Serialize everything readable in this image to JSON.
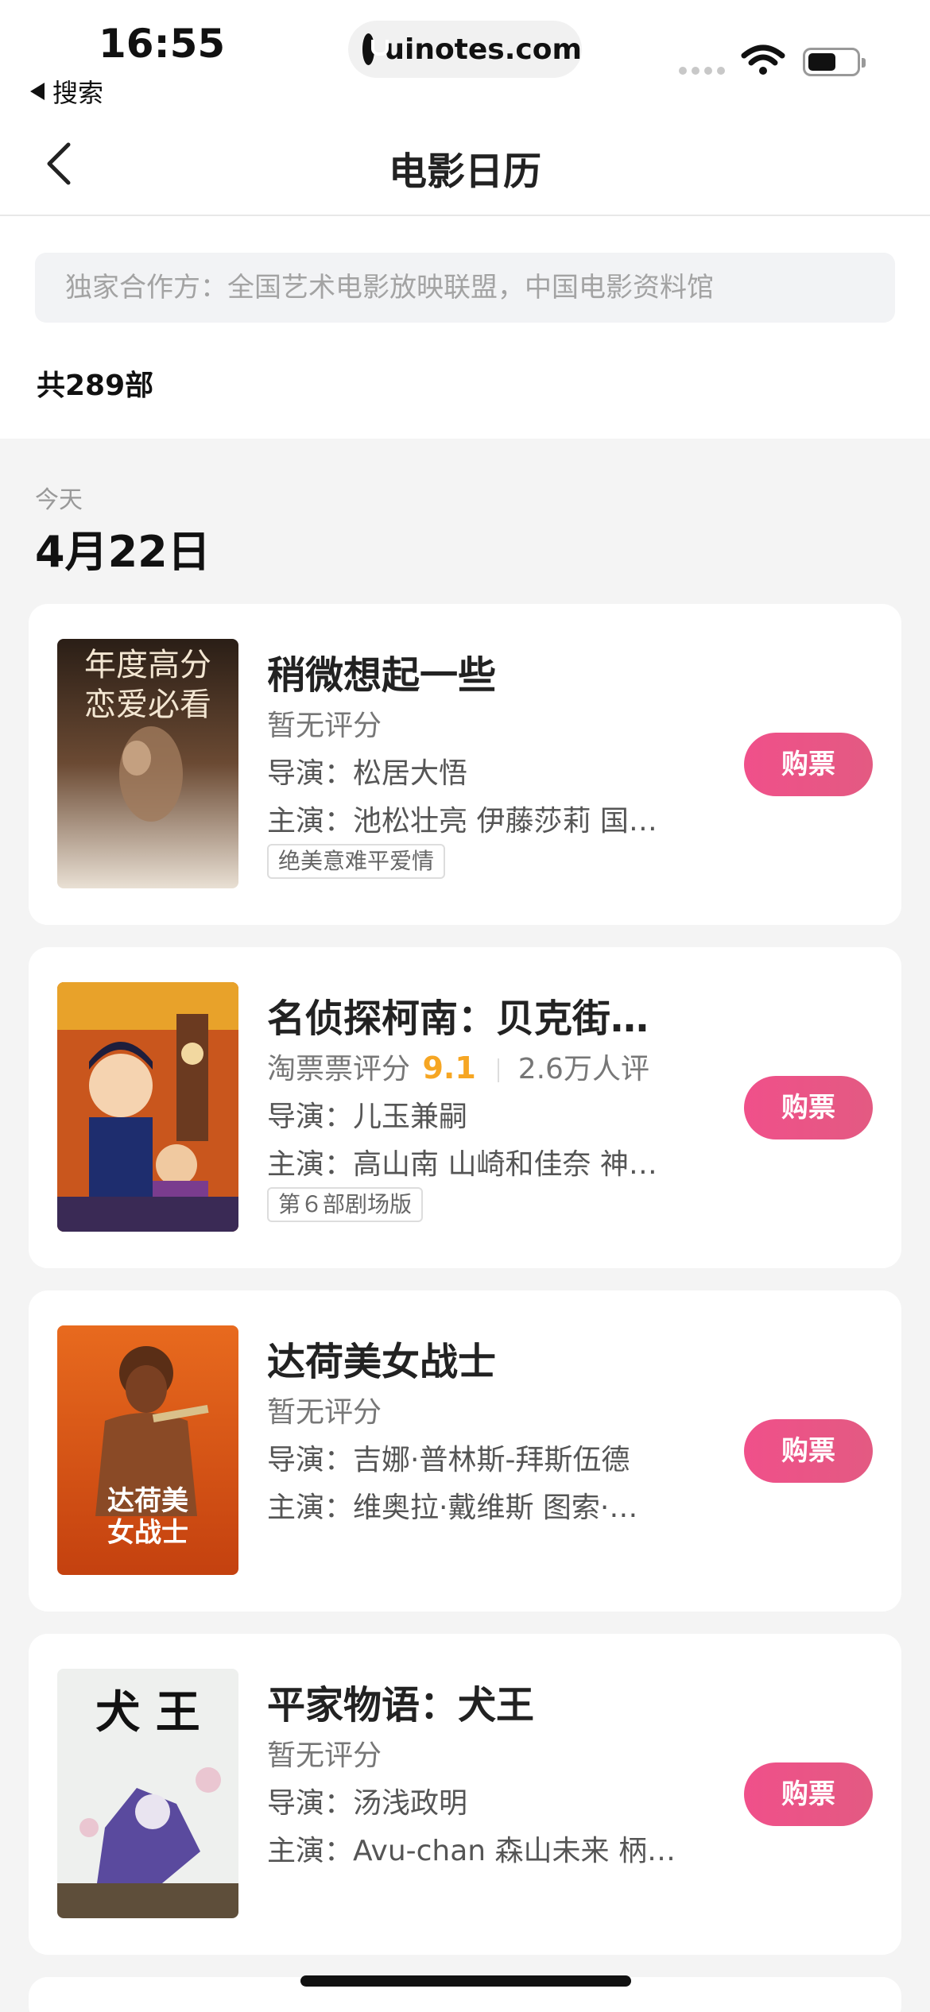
{
  "status_bar": {
    "time": "16:55",
    "back_app": "搜索",
    "url": "uinotes.com",
    "icons": [
      "signal-icon",
      "wifi-icon",
      "battery-icon"
    ]
  },
  "nav": {
    "title": "电影日历",
    "back_icon": "chevron-left-icon"
  },
  "header": {
    "partner_text": "独家合作方：全国艺术电影放映联盟，中国电影资料馆",
    "total_count": "共289部"
  },
  "date_group": {
    "sub_label": "今天",
    "date": "4月22日"
  },
  "films": [
    {
      "title": "稍微想起一些",
      "score_text": "暂无评分",
      "director": "导演：松居大悟",
      "cast": "主演：池松壮亮 伊藤莎莉 国…",
      "tag": "绝美意难平爱情",
      "poster_caption_1": "年度高分",
      "poster_caption_2": "恋爱必看",
      "button": "购票"
    },
    {
      "title": "名侦探柯南：贝克街…",
      "score_label": "淘票票评分",
      "score_value": "9.1",
      "rating_count": "2.6万人评",
      "director": "导演：儿玉兼嗣",
      "cast": "主演：高山南 山崎和佳奈 神…",
      "tag": "第６部剧场版",
      "button": "购票"
    },
    {
      "title": "达荷美女战士",
      "score_text": "暂无评分",
      "director": "导演：吉娜·普林斯-拜斯伍德",
      "cast": "主演：维奥拉·戴维斯 图索·…",
      "poster_caption_1": "达荷美",
      "poster_caption_2": "女战士",
      "button": "购票"
    },
    {
      "title": "平家物语：犬王",
      "score_text": "暂无评分",
      "director": "导演：汤浅政明",
      "cast": "主演：Avu-chan 森山未来 柄…",
      "poster_caption_1": "犬 王",
      "button": "购票"
    }
  ],
  "colors": {
    "accent_pink": "#eb5488",
    "score_orange": "#f6a623",
    "page_bg": "#f4f4f4"
  }
}
